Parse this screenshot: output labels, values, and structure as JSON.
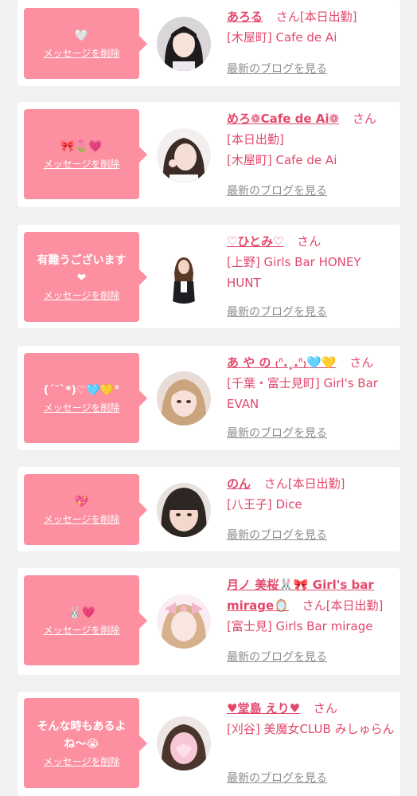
{
  "delete_label": "メッセージを削除",
  "blog_label": "最新のブログを見る",
  "san": "さん",
  "colors": {
    "bubble": "#fc8fa0",
    "accent": "#e2486b",
    "muted": "#8c8c8c",
    "background": "#f1f1f1"
  },
  "cards": [
    {
      "message": "🤍",
      "name": "あろる",
      "status": "[本日出勤]",
      "shop": "[木屋町] Cafe de Ai",
      "avatar": "avatar-photo-dark-hair"
    },
    {
      "message": "🎀🌷💗",
      "name": "めろ❁Cafe de Ai❁",
      "status": "[本日出勤]",
      "shop": "[木屋町] Cafe de Ai",
      "avatar": "avatar-photo-peace-sign"
    },
    {
      "message": "有難うございます\n❤",
      "name": "♡ひとみ♡",
      "status": "",
      "shop": "[上野] Girls Bar HONEY HUNT",
      "avatar": "avatar-photo-standing"
    },
    {
      "message": "(ˊ˘ˋ*)♡🩵💛°",
      "name": "あ や の ₍ᐢ.ˬ.ᐢ₎🩵💛",
      "status": "",
      "shop": "[千葉・富士見町] Girl's Bar EVAN",
      "avatar": "avatar-photo-blonde"
    },
    {
      "message": "💖",
      "name": "のん",
      "status": "[本日出勤]",
      "shop": "[八王子] Dice",
      "avatar": "avatar-photo-bangs"
    },
    {
      "message": "🐰💗",
      "name": "月ノ 美桜🐰🎀 Girl's bar mirage🪞",
      "status": "[本日出勤]",
      "shop": "[富士見] Girls Bar mirage",
      "avatar": "avatar-photo-bow"
    },
    {
      "message": "そんな時もあるよね〜😭",
      "name": "♥堂島 えり♥",
      "status": "",
      "shop": "[刈谷] 美魔女CLUB みしゅらん",
      "avatar": "avatar-photo-blurred"
    }
  ]
}
